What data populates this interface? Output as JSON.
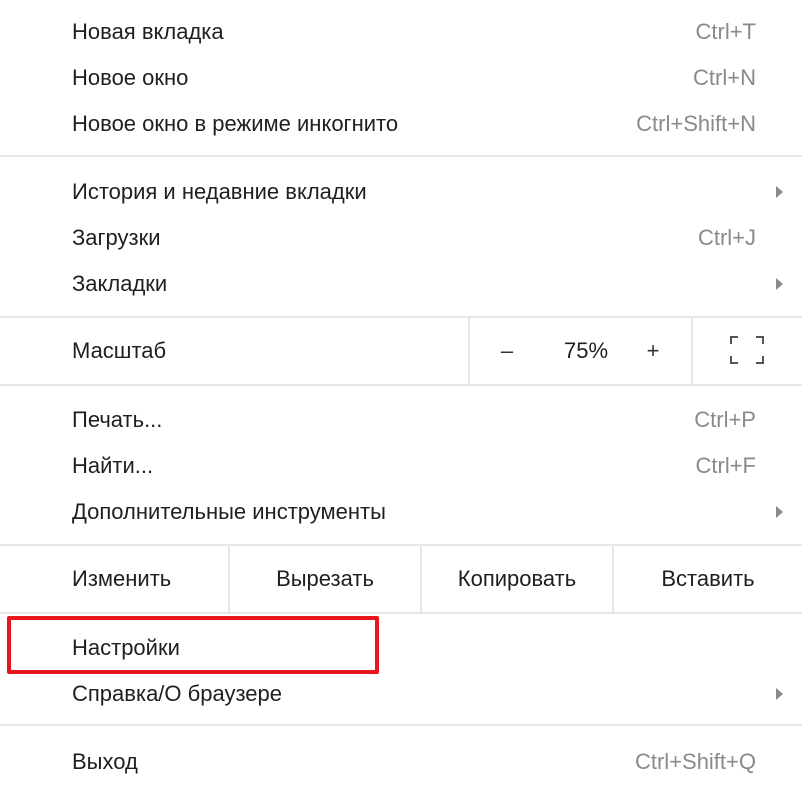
{
  "menu": {
    "group1": [
      {
        "label": "Новая вкладка",
        "shortcut": "Ctrl+T"
      },
      {
        "label": "Новое окно",
        "shortcut": "Ctrl+N"
      },
      {
        "label": "Новое окно в режиме инкогнито",
        "shortcut": "Ctrl+Shift+N"
      }
    ],
    "group2": [
      {
        "label": "История и недавние вкладки",
        "submenu": true
      },
      {
        "label": "Загрузки",
        "shortcut": "Ctrl+J"
      },
      {
        "label": "Закладки",
        "submenu": true
      }
    ],
    "zoom": {
      "label": "Масштаб",
      "minus": "–",
      "value": "75%",
      "plus": "+",
      "fullscreen_icon": "fullscreen-icon"
    },
    "group3": [
      {
        "label": "Печать...",
        "shortcut": "Ctrl+P"
      },
      {
        "label": "Найти...",
        "shortcut": "Ctrl+F"
      },
      {
        "label": "Дополнительные инструменты",
        "submenu": true
      }
    ],
    "edit": {
      "label": "Изменить",
      "cut": "Вырезать",
      "copy": "Копировать",
      "paste": "Вставить"
    },
    "group4": [
      {
        "label": "Настройки",
        "highlighted": true
      },
      {
        "label": "Справка/О браузере",
        "submenu": true
      }
    ],
    "exit": {
      "label": "Выход",
      "shortcut": "Ctrl+Shift+Q"
    },
    "colors": {
      "highlight_border": "#e8151b",
      "separator": "#e6e6e6",
      "shortcut_text": "#8a8a8a"
    }
  }
}
